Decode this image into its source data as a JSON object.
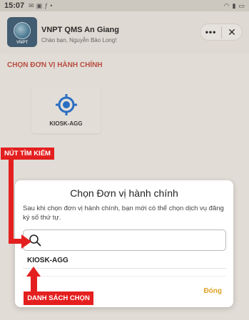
{
  "status_bar": {
    "time": "15:07"
  },
  "app": {
    "title": "VNPT QMS An Giang",
    "subtitle": "Chào bạn, Nguyễn Bảo Long!",
    "logo_text": "VNPT",
    "more_label": "•••",
    "close_label": "✕"
  },
  "background": {
    "section_title": "CHỌN ĐƠN VỊ HÀNH CHÍNH",
    "kiosk_card_label": "KIOSK-AGG"
  },
  "dialog": {
    "title": "Chọn Đơn vị hành chính",
    "description": "Sau khi chọn đơn vị hành chính, bạn mới có thể chọn dịch vụ đăng ký số thứ tự.",
    "search": {
      "placeholder": "",
      "value": "",
      "icon": "search-icon"
    },
    "items": [
      {
        "label": "KIOSK-AGG"
      }
    ],
    "close_label": "Đóng"
  },
  "annotations": {
    "search_button_label": "NÚT TÌM KIẾM",
    "list_label": "DANH SÁCH CHỌN"
  },
  "colors": {
    "annotation_red": "#e41f1f",
    "accent_orange": "#e0a22a",
    "section_red": "#c14a3c",
    "kiosk_blue": "#1f6fd1"
  }
}
